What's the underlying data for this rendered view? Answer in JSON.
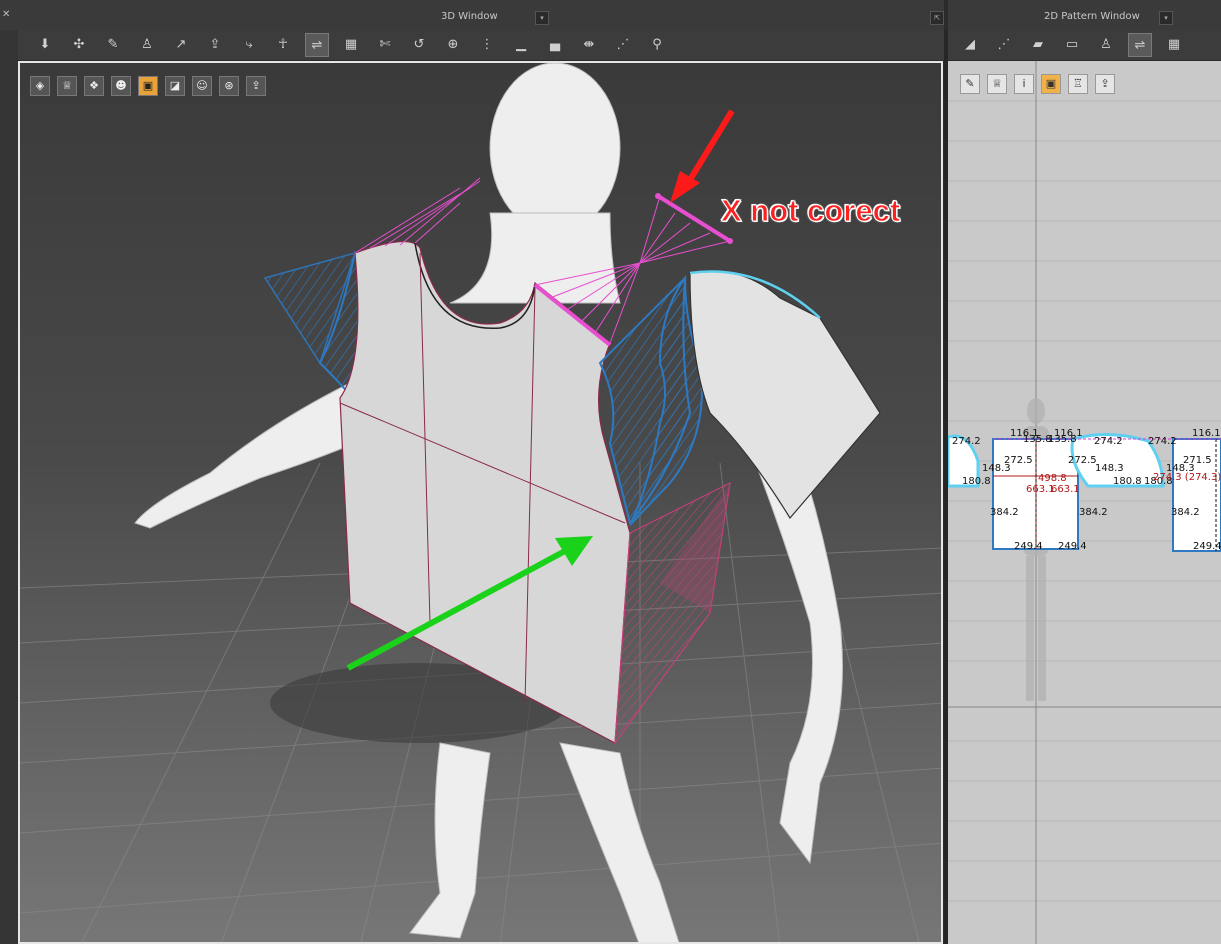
{
  "window3d": {
    "title": "3D Window",
    "dropdown_glyph": "▾",
    "undock_glyph": "⇱",
    "close_glyph": "✕",
    "toolbar": [
      {
        "icon": "arrange-icon",
        "glyph": "⬇"
      },
      {
        "icon": "move-point-icon",
        "glyph": "✣"
      },
      {
        "icon": "pin-icon",
        "glyph": "✎"
      },
      {
        "icon": "garment-select-icon",
        "glyph": "♙"
      },
      {
        "icon": "measure-icon",
        "glyph": "↗"
      },
      {
        "icon": "fold-icon",
        "glyph": "⇪"
      },
      {
        "icon": "tack-icon",
        "glyph": "⤷"
      },
      {
        "icon": "avatar-icon",
        "glyph": "☥"
      },
      {
        "icon": "seam-icon",
        "glyph": "⇌"
      },
      {
        "icon": "grid-seam-icon",
        "glyph": "▦"
      },
      {
        "icon": "edit-seam-icon",
        "glyph": "✄"
      },
      {
        "icon": "strap-icon",
        "glyph": "↺"
      },
      {
        "icon": "button-icon",
        "glyph": "⊕"
      },
      {
        "icon": "zipper-icon",
        "glyph": "⋮"
      },
      {
        "icon": "topstitch-icon",
        "glyph": "▁"
      },
      {
        "icon": "piping-icon",
        "glyph": "▄"
      },
      {
        "icon": "tuck-icon",
        "glyph": "⇼"
      },
      {
        "icon": "pleat-icon",
        "glyph": "⋰"
      },
      {
        "icon": "pose-icon",
        "glyph": "⚲"
      }
    ],
    "view_buttons": [
      {
        "icon": "texture-view-icon",
        "glyph": "◈"
      },
      {
        "icon": "garment-view-icon",
        "glyph": "♕"
      },
      {
        "icon": "particle-view-icon",
        "glyph": "❖"
      },
      {
        "icon": "avatar-view-icon",
        "glyph": "☻"
      },
      {
        "icon": "fabric-view-icon",
        "glyph": "▣"
      },
      {
        "icon": "surface-view-icon",
        "glyph": "◪"
      },
      {
        "icon": "skin-view-icon",
        "glyph": "☺"
      },
      {
        "icon": "globe-view-icon",
        "glyph": "⊛"
      },
      {
        "icon": "export-view-icon",
        "glyph": "⇪"
      }
    ],
    "annotation_text": "X not corect",
    "colors": {
      "bg_top": "#3b3b3b",
      "bg_bottom": "#6e6e6e",
      "seam_pink": "#e84fd0",
      "seam_blue": "#2d79c2",
      "arrow_red": "#ff1a1a",
      "arrow_green": "#1bd21b",
      "panel_fill": "#d9d9d9",
      "panel_edge": "#8a2a4a"
    }
  },
  "window2d": {
    "title": "2D Pattern Window",
    "dropdown_glyph": "▾",
    "toolbar": [
      {
        "icon": "transform-pattern-icon",
        "glyph": "◢"
      },
      {
        "icon": "edit-point-icon",
        "glyph": "⋰"
      },
      {
        "icon": "edit-pattern-icon",
        "glyph": "▰"
      },
      {
        "icon": "polygon-icon",
        "glyph": "▭"
      },
      {
        "icon": "avatar-pose-icon",
        "glyph": "♙"
      },
      {
        "icon": "segment-seam-icon",
        "glyph": "⇌"
      },
      {
        "icon": "free-seam-icon",
        "glyph": "▦"
      }
    ],
    "view_buttons": [
      {
        "icon": "needle-view-icon",
        "glyph": "✎"
      },
      {
        "icon": "shirt-view-icon",
        "glyph": "♕"
      },
      {
        "icon": "info-view-icon",
        "glyph": "i"
      },
      {
        "icon": "fabric-color-view-icon",
        "glyph": "▣"
      },
      {
        "icon": "lock-view-icon",
        "glyph": "♖"
      },
      {
        "icon": "export-view-icon-2d",
        "glyph": "⇪"
      }
    ],
    "measurements": {
      "m1": "274.2",
      "m2": "116.1",
      "m3": "135.8",
      "m4": "135.8",
      "m5": "116.1",
      "m6": "116.1",
      "m7": "274.2",
      "m8": "274.2",
      "m9": "116.1",
      "m10": "272.5",
      "m11": "272.5",
      "m12": "148.3",
      "m13": "148.3",
      "m14": "148.3",
      "m15": "271.5",
      "m16": "180.8",
      "m17": "180.8",
      "m18": "180.8",
      "m19": "498.8",
      "m20": "663.1",
      "m21": "663.1",
      "m22": "274.3 (274.3)",
      "m23": "384.2",
      "m24": "384.2",
      "m25": "384.2",
      "m26": "249.4",
      "m27": "249.4",
      "m28": "249.4"
    }
  }
}
